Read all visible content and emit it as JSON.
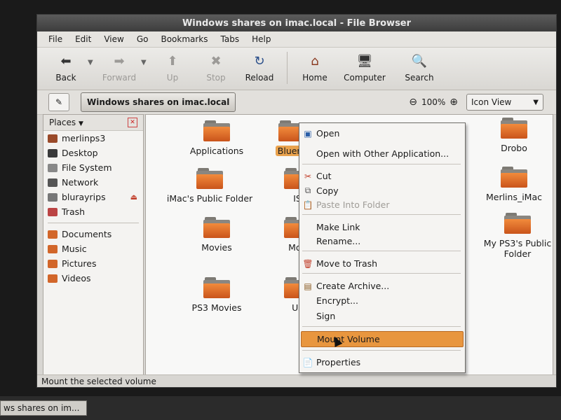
{
  "window": {
    "title": "Windows shares on imac.local - File Browser"
  },
  "menubar": [
    "File",
    "Edit",
    "View",
    "Go",
    "Bookmarks",
    "Tabs",
    "Help"
  ],
  "toolbar": {
    "back": "Back",
    "forward": "Forward",
    "up": "Up",
    "stop": "Stop",
    "reload": "Reload",
    "home": "Home",
    "computer": "Computer",
    "search": "Search"
  },
  "location": {
    "path": "Windows shares on imac.local",
    "zoom": "100%",
    "view_mode": "Icon View"
  },
  "sidebar": {
    "header": "Places",
    "items": [
      {
        "label": "merlinps3",
        "icon": "home-icon"
      },
      {
        "label": "Desktop",
        "icon": "desktop-icon"
      },
      {
        "label": "File System",
        "icon": "harddisk-icon"
      },
      {
        "label": "Network",
        "icon": "network-icon"
      },
      {
        "label": "blurayrips",
        "icon": "network-drive-icon"
      },
      {
        "label": "Trash",
        "icon": "trash-icon"
      }
    ],
    "bookmarks": [
      {
        "label": "Documents",
        "icon": "folder-icon"
      },
      {
        "label": "Music",
        "icon": "folder-icon"
      },
      {
        "label": "Pictures",
        "icon": "folder-icon"
      },
      {
        "label": "Videos",
        "icon": "folder-icon"
      }
    ]
  },
  "files": [
    {
      "name": "Applications"
    },
    {
      "name": "Bluera"
    },
    {
      "name": "Drobo"
    },
    {
      "name": "iMac's Public Folder"
    },
    {
      "name": "IS"
    },
    {
      "name": "Merlins_iMac"
    },
    {
      "name": "Movies"
    },
    {
      "name": "Mov"
    },
    {
      "name": "My PS3's Public Folder"
    },
    {
      "name": "PS3 Movies"
    },
    {
      "name": "Us"
    }
  ],
  "context_menu": {
    "open": "Open",
    "open_with": "Open with Other Application...",
    "cut": "Cut",
    "copy": "Copy",
    "paste_into": "Paste Into Folder",
    "make_link": "Make Link",
    "rename": "Rename...",
    "move_trash": "Move to Trash",
    "create_archive": "Create Archive...",
    "encrypt": "Encrypt...",
    "sign": "Sign",
    "mount_volume": "Mount Volume",
    "properties": "Properties"
  },
  "status": "Mount the selected volume",
  "taskbar": {
    "task": "ws shares on im..."
  },
  "colors": {
    "accent": "#e8963f",
    "folder": "#e0692a"
  }
}
